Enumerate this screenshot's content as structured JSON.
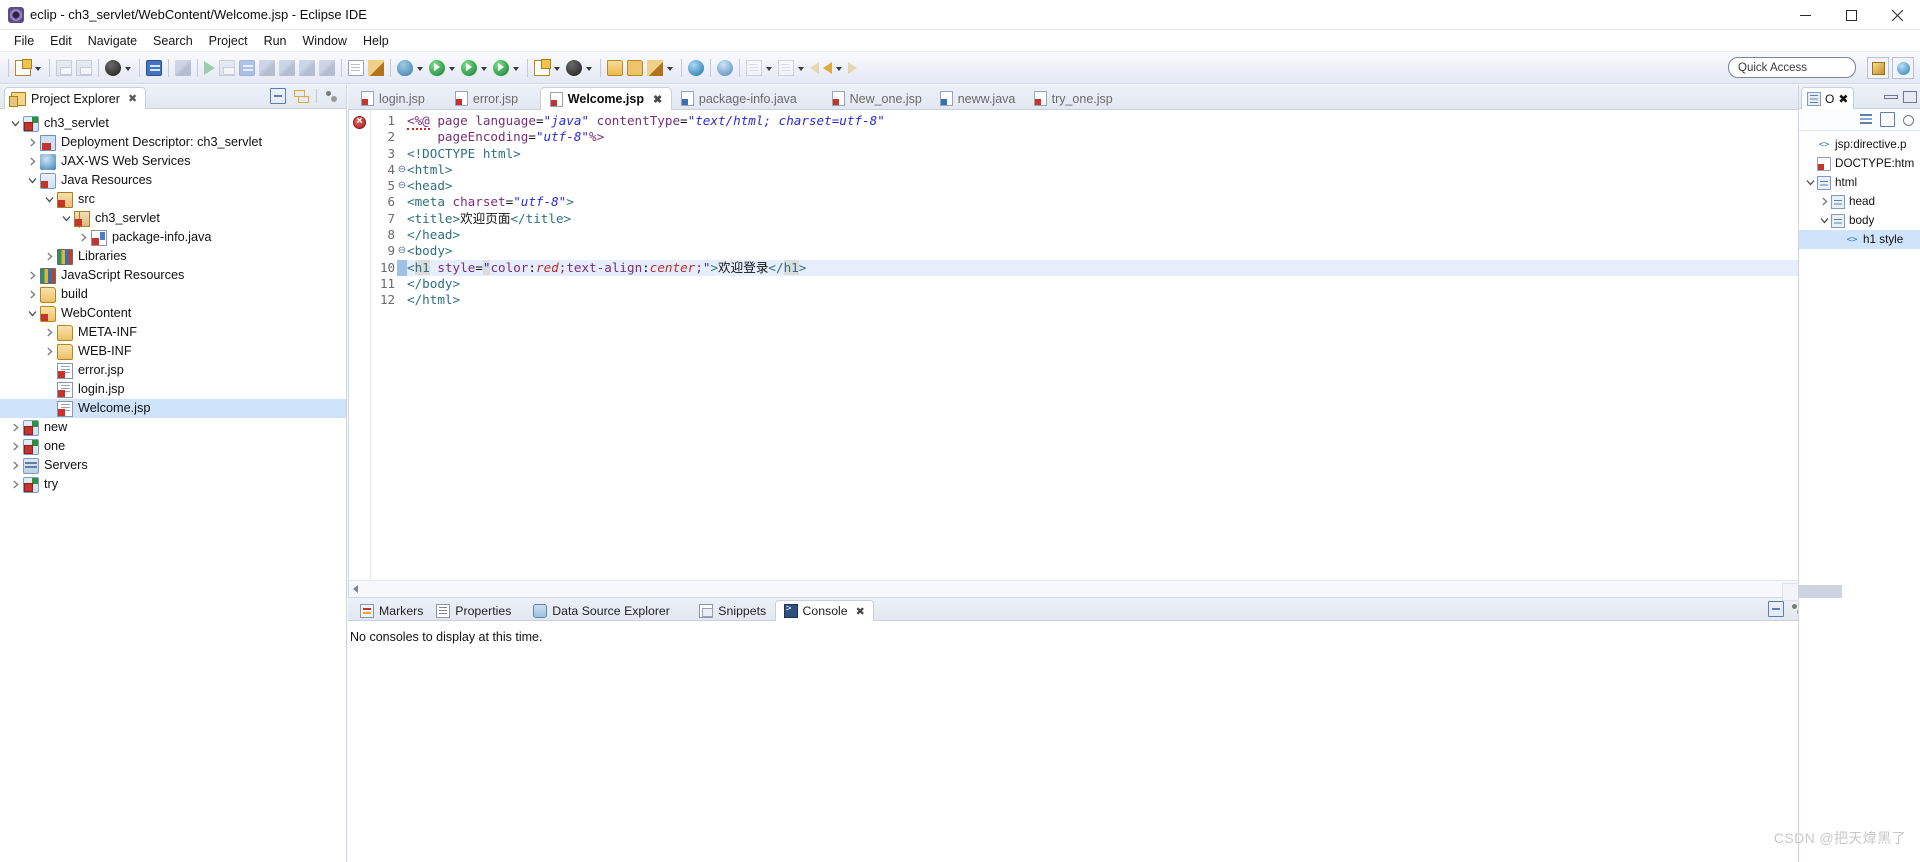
{
  "window": {
    "title": "eclip - ch3_servlet/WebContent/Welcome.jsp - Eclipse IDE",
    "minimize_label": "–",
    "maximize_label": "☐",
    "close_label": "×"
  },
  "menubar": {
    "items": [
      "File",
      "Edit",
      "Navigate",
      "Search",
      "Project",
      "Run",
      "Window",
      "Help"
    ]
  },
  "toolbar": {
    "quick_access_placeholder": "Quick Access",
    "items": [
      {
        "name": "new-wizard",
        "icon": "new-document-icon",
        "has_arrow": true
      },
      {
        "name": "save",
        "icon": "save-icon",
        "has_arrow": false
      },
      {
        "name": "save-all",
        "icon": "save-all-icon",
        "has_arrow": false
      },
      {
        "name": "print",
        "icon": "print-icon",
        "has_arrow": true
      },
      {
        "name": "open-console",
        "icon": "console-icon",
        "has_arrow": false
      },
      {
        "name": "toggle-mark",
        "icon": "pencil-icon",
        "has_arrow": false
      },
      {
        "name": "resume",
        "icon": "resume-icon",
        "has_arrow": false
      },
      {
        "name": "suspend",
        "icon": "suspend-icon",
        "has_arrow": false
      },
      {
        "name": "terminate",
        "icon": "terminate-icon",
        "has_arrow": false
      },
      {
        "name": "step-into",
        "icon": "step-into-icon",
        "has_arrow": false
      },
      {
        "name": "step-over",
        "icon": "step-over-icon",
        "has_arrow": false
      },
      {
        "name": "step-return",
        "icon": "step-return-icon",
        "has_arrow": false
      },
      {
        "name": "drop-to-frame",
        "icon": "drop-frame-icon",
        "has_arrow": false
      },
      {
        "name": "new-java-class",
        "icon": "java-class-icon",
        "has_arrow": false
      },
      {
        "name": "new-java-project",
        "icon": "java-project-icon",
        "has_arrow": false
      },
      {
        "name": "debug",
        "icon": "debug-bug-icon",
        "has_arrow": true
      },
      {
        "name": "run",
        "icon": "run-green-icon",
        "has_arrow": true
      },
      {
        "name": "run-as-server",
        "icon": "run-server-icon",
        "has_arrow": true
      },
      {
        "name": "profile",
        "icon": "profile-icon",
        "has_arrow": true
      },
      {
        "name": "new-wizard-2",
        "icon": "new-wizard-icon",
        "has_arrow": true
      },
      {
        "name": "search-engine",
        "icon": "search-engine-icon",
        "has_arrow": true
      },
      {
        "name": "open-type",
        "icon": "open-folder-icon",
        "has_arrow": false
      },
      {
        "name": "open-resource",
        "icon": "folder-icon",
        "has_arrow": false
      },
      {
        "name": "annotate",
        "icon": "brush-icon",
        "has_arrow": true
      },
      {
        "name": "open-web-browser",
        "icon": "globe-icon",
        "has_arrow": false
      },
      {
        "name": "web-preview",
        "icon": "web-preview-icon",
        "has_arrow": false
      },
      {
        "name": "next-annotation",
        "icon": "next-annotation-icon",
        "has_arrow": true
      },
      {
        "name": "previous-annotation",
        "icon": "previous-annotation-icon",
        "has_arrow": true
      },
      {
        "name": "last-edit-location",
        "icon": "last-edit-icon",
        "has_arrow": false
      },
      {
        "name": "back",
        "icon": "back-arrow-icon",
        "has_arrow": true
      },
      {
        "name": "forward",
        "icon": "forward-arrow-icon",
        "has_arrow": false
      }
    ]
  },
  "project_explorer": {
    "tab_label": "Project Explorer",
    "close_label": "✖",
    "tools": [
      "collapse-all-icon",
      "link-with-editor-icon",
      "view-menu-icon"
    ],
    "tree": [
      {
        "label": "ch3_servlet",
        "depth": 0,
        "twisty": "down",
        "icon": "project-icon",
        "selected": false
      },
      {
        "label": "Deployment Descriptor: ch3_servlet",
        "depth": 1,
        "twisty": "right",
        "icon": "deployment-descriptor-icon",
        "selected": false
      },
      {
        "label": "JAX-WS Web Services",
        "depth": 1,
        "twisty": "right",
        "icon": "jax-ws-icon",
        "selected": false
      },
      {
        "label": "Java Resources",
        "depth": 1,
        "twisty": "down",
        "icon": "java-resources-icon",
        "selected": false
      },
      {
        "label": "src",
        "depth": 2,
        "twisty": "down",
        "icon": "source-folder-icon",
        "selected": false
      },
      {
        "label": "ch3_servlet",
        "depth": 3,
        "twisty": "down",
        "icon": "package-icon",
        "selected": false
      },
      {
        "label": "package-info.java",
        "depth": 4,
        "twisty": "right",
        "icon": "java-file-icon",
        "selected": false
      },
      {
        "label": "Libraries",
        "depth": 2,
        "twisty": "right",
        "icon": "libraries-icon",
        "selected": false
      },
      {
        "label": "JavaScript Resources",
        "depth": 1,
        "twisty": "right",
        "icon": "javascript-resources-icon",
        "selected": false
      },
      {
        "label": "build",
        "depth": 1,
        "twisty": "right",
        "icon": "folder-icon",
        "selected": false
      },
      {
        "label": "WebContent",
        "depth": 1,
        "twisty": "down",
        "icon": "webcontent-folder-icon",
        "selected": false
      },
      {
        "label": "META-INF",
        "depth": 2,
        "twisty": "right",
        "icon": "folder-icon",
        "selected": false
      },
      {
        "label": "WEB-INF",
        "depth": 2,
        "twisty": "right",
        "icon": "folder-icon",
        "selected": false
      },
      {
        "label": "error.jsp",
        "depth": 2,
        "twisty": "none",
        "icon": "jsp-file-icon",
        "selected": false
      },
      {
        "label": "login.jsp",
        "depth": 2,
        "twisty": "none",
        "icon": "jsp-file-icon",
        "selected": false
      },
      {
        "label": "Welcome.jsp",
        "depth": 2,
        "twisty": "none",
        "icon": "jsp-file-icon",
        "selected": true
      },
      {
        "label": "new",
        "depth": 0,
        "twisty": "right",
        "icon": "project-icon",
        "selected": false
      },
      {
        "label": "one",
        "depth": 0,
        "twisty": "right",
        "icon": "project-icon",
        "selected": false
      },
      {
        "label": "Servers",
        "depth": 0,
        "twisty": "right",
        "icon": "server-icon",
        "selected": false
      },
      {
        "label": "try",
        "depth": 0,
        "twisty": "right",
        "icon": "project-icon",
        "selected": false
      }
    ]
  },
  "editor": {
    "tabs": [
      {
        "label": "login.jsp",
        "icon": "jsp-file-icon",
        "active": false,
        "closable": false
      },
      {
        "label": "error.jsp",
        "icon": "jsp-file-icon",
        "active": false,
        "closable": false
      },
      {
        "label": "Welcome.jsp",
        "icon": "jsp-file-icon",
        "active": true,
        "closable": true,
        "close_label": "✖"
      },
      {
        "label": "package-info.java",
        "icon": "java-file-icon",
        "active": false,
        "closable": false
      },
      {
        "label": "New_one.jsp",
        "icon": "jsp-file-icon",
        "active": false,
        "closable": false
      },
      {
        "label": "neww.java",
        "icon": "java-file-icon",
        "active": false,
        "closable": false
      },
      {
        "label": "try_one.jsp",
        "icon": "jsp-file-icon",
        "active": false,
        "closable": false
      }
    ],
    "error_marker": "error-marker-icon",
    "current_line": 10,
    "lines": [
      {
        "no": 1,
        "fold": "",
        "highlight": false
      },
      {
        "no": 2,
        "fold": "",
        "highlight": false
      },
      {
        "no": 3,
        "fold": "",
        "highlight": false
      },
      {
        "no": 4,
        "fold": "⊖",
        "highlight": false
      },
      {
        "no": 5,
        "fold": "⊖",
        "highlight": false
      },
      {
        "no": 6,
        "fold": "",
        "highlight": false
      },
      {
        "no": 7,
        "fold": "",
        "highlight": false
      },
      {
        "no": 8,
        "fold": "",
        "highlight": false
      },
      {
        "no": 9,
        "fold": "⊖",
        "highlight": false
      },
      {
        "no": 10,
        "fold": "",
        "highlight": true
      },
      {
        "no": 11,
        "fold": "",
        "highlight": false
      },
      {
        "no": 12,
        "fold": "",
        "highlight": false
      }
    ],
    "code_text": [
      "<%@ page language=\"java\" contentType=\"text/html; charset=utf-8\"",
      "    pageEncoding=\"utf-8\"%>",
      "<!DOCTYPE html>",
      "<html>",
      "<head>",
      "<meta charset=\"utf-8\">",
      "<title>欢迎页面</title>",
      "</head>",
      "<body>",
      "<h1 style=\"color:red;text-align:center;\">欢迎登录</h1>",
      "</body>",
      "</html>"
    ]
  },
  "outline": {
    "tab_label": "O",
    "close_label": "✖",
    "tools": [
      "sort-icon",
      "collapse-all-icon",
      "view-menu-icon"
    ],
    "tree": [
      {
        "label": "jsp:directive.p",
        "depth": 0,
        "twisty": "none",
        "icon": "jsp-directive-icon",
        "selected": false
      },
      {
        "label": "DOCTYPE:htm",
        "depth": 0,
        "twisty": "none",
        "icon": "doctype-icon",
        "selected": false
      },
      {
        "label": "html",
        "depth": 0,
        "twisty": "down",
        "icon": "html-tag-icon",
        "selected": false
      },
      {
        "label": "head",
        "depth": 1,
        "twisty": "right",
        "icon": "html-tag-icon",
        "selected": false
      },
      {
        "label": "body",
        "depth": 1,
        "twisty": "down",
        "icon": "html-tag-icon",
        "selected": false
      },
      {
        "label": "h1 style",
        "depth": 2,
        "twisty": "none",
        "icon": "html-attr-icon",
        "selected": true
      }
    ]
  },
  "bottom_panel": {
    "tabs": [
      {
        "label": "Markers",
        "icon": "markers-icon",
        "active": false
      },
      {
        "label": "Properties",
        "icon": "properties-icon",
        "active": false
      },
      {
        "label": "Data Source Explorer",
        "icon": "data-source-icon",
        "active": false
      },
      {
        "label": "Snippets",
        "icon": "snippets-icon",
        "active": false
      },
      {
        "label": "Console",
        "icon": "console-icon",
        "active": true,
        "close_label": "✖"
      }
    ],
    "console_message": "No consoles to display at this time."
  },
  "watermark": "CSDN @把天煒黑了"
}
